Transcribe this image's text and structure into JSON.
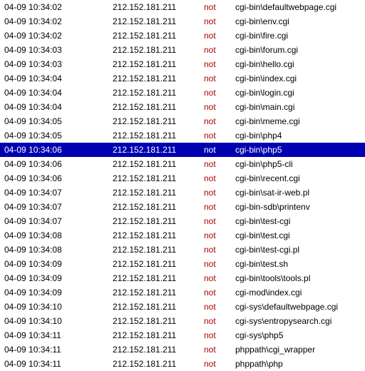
{
  "rows": [
    {
      "ts": "04-09 10:34:02",
      "ip": "212.152.181.211",
      "flag": "not",
      "path": "cgi-bin\\defaultwebpage.cgi",
      "selected": false
    },
    {
      "ts": "04-09 10:34:02",
      "ip": "212.152.181.211",
      "flag": "not",
      "path": "cgi-bin\\env.cgi",
      "selected": false
    },
    {
      "ts": "04-09 10:34:02",
      "ip": "212.152.181.211",
      "flag": "not",
      "path": "cgi-bin\\fire.cgi",
      "selected": false
    },
    {
      "ts": "04-09 10:34:03",
      "ip": "212.152.181.211",
      "flag": "not",
      "path": "cgi-bin\\forum.cgi",
      "selected": false
    },
    {
      "ts": "04-09 10:34:03",
      "ip": "212.152.181.211",
      "flag": "not",
      "path": "cgi-bin\\hello.cgi",
      "selected": false
    },
    {
      "ts": "04-09 10:34:04",
      "ip": "212.152.181.211",
      "flag": "not",
      "path": "cgi-bin\\index.cgi",
      "selected": false
    },
    {
      "ts": "04-09 10:34:04",
      "ip": "212.152.181.211",
      "flag": "not",
      "path": "cgi-bin\\login.cgi",
      "selected": false
    },
    {
      "ts": "04-09 10:34:04",
      "ip": "212.152.181.211",
      "flag": "not",
      "path": "cgi-bin\\main.cgi",
      "selected": false
    },
    {
      "ts": "04-09 10:34:05",
      "ip": "212.152.181.211",
      "flag": "not",
      "path": "cgi-bin\\meme.cgi",
      "selected": false
    },
    {
      "ts": "04-09 10:34:05",
      "ip": "212.152.181.211",
      "flag": "not",
      "path": "cgi-bin\\php4",
      "selected": false
    },
    {
      "ts": "04-09 10:34:06",
      "ip": "212.152.181.211",
      "flag": "not",
      "path": "cgi-bin\\php5",
      "selected": true
    },
    {
      "ts": "04-09 10:34:06",
      "ip": "212.152.181.211",
      "flag": "not",
      "path": "cgi-bin\\php5-cli",
      "selected": false
    },
    {
      "ts": "04-09 10:34:06",
      "ip": "212.152.181.211",
      "flag": "not",
      "path": "cgi-bin\\recent.cgi",
      "selected": false
    },
    {
      "ts": "04-09 10:34:07",
      "ip": "212.152.181.211",
      "flag": "not",
      "path": "cgi-bin\\sat-ir-web.pl",
      "selected": false
    },
    {
      "ts": "04-09 10:34:07",
      "ip": "212.152.181.211",
      "flag": "not",
      "path": "cgi-bin-sdb\\printenv",
      "selected": false
    },
    {
      "ts": "04-09 10:34:07",
      "ip": "212.152.181.211",
      "flag": "not",
      "path": "cgi-bin\\test-cgi",
      "selected": false
    },
    {
      "ts": "04-09 10:34:08",
      "ip": "212.152.181.211",
      "flag": "not",
      "path": "cgi-bin\\test.cgi",
      "selected": false
    },
    {
      "ts": "04-09 10:34:08",
      "ip": "212.152.181.211",
      "flag": "not",
      "path": "cgi-bin\\test-cgi.pl",
      "selected": false
    },
    {
      "ts": "04-09 10:34:09",
      "ip": "212.152.181.211",
      "flag": "not",
      "path": "cgi-bin\\test.sh",
      "selected": false
    },
    {
      "ts": "04-09 10:34:09",
      "ip": "212.152.181.211",
      "flag": "not",
      "path": "cgi-bin\\tools\\tools.pl",
      "selected": false
    },
    {
      "ts": "04-09 10:34:09",
      "ip": "212.152.181.211",
      "flag": "not",
      "path": "cgi-mod\\index.cgi",
      "selected": false
    },
    {
      "ts": "04-09 10:34:10",
      "ip": "212.152.181.211",
      "flag": "not",
      "path": "cgi-sys\\defaultwebpage.cgi",
      "selected": false
    },
    {
      "ts": "04-09 10:34:10",
      "ip": "212.152.181.211",
      "flag": "not",
      "path": "cgi-sys\\entropysearch.cgi",
      "selected": false
    },
    {
      "ts": "04-09 10:34:11",
      "ip": "212.152.181.211",
      "flag": "not",
      "path": "cgi-sys\\php5",
      "selected": false
    },
    {
      "ts": "04-09 10:34:11",
      "ip": "212.152.181.211",
      "flag": "not",
      "path": "phppath\\cgi_wrapper",
      "selected": false
    },
    {
      "ts": "04-09 10:34:11",
      "ip": "212.152.181.211",
      "flag": "not",
      "path": "phppath\\php",
      "selected": false
    }
  ]
}
